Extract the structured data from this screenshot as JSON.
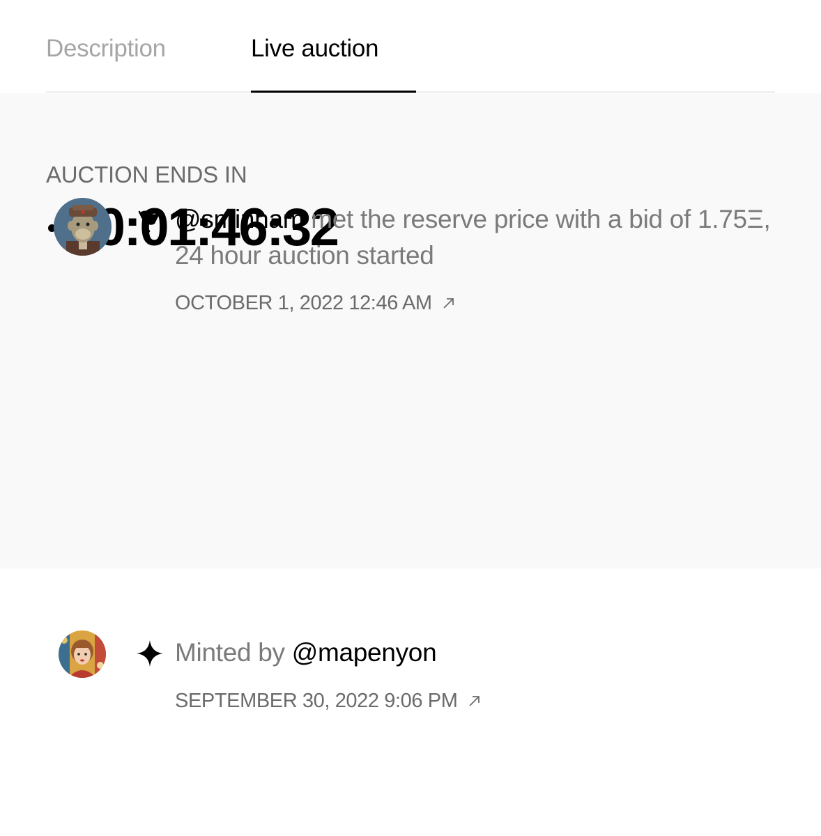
{
  "tabs": [
    {
      "label": "Description",
      "active": false
    },
    {
      "label": "Live auction",
      "active": true
    }
  ],
  "auction": {
    "ends_label": "AUCTION ENDS IN",
    "countdown": "00:01:46:32"
  },
  "reserve_event": {
    "icon": "flag-icon",
    "handle": "@sminnam",
    "text": " met the reserve price with a bid of 1.75Ξ, 24 hour auction started",
    "timestamp": "OCTOBER 1, 2022 12:46 AM",
    "link_icon": "arrow-up-right-icon"
  },
  "mint_event": {
    "icon": "sparkle-icon",
    "prefix": "Minted by ",
    "handle": "@mapenyon",
    "timestamp": "SEPTEMBER 30, 2022 9:06 PM",
    "link_icon": "arrow-up-right-icon"
  },
  "colors": {
    "panel_bg": "#f9f9f9",
    "muted_text": "#7a7a7a",
    "inactive_tab": "#a6a6a6",
    "accent": "#000000"
  }
}
